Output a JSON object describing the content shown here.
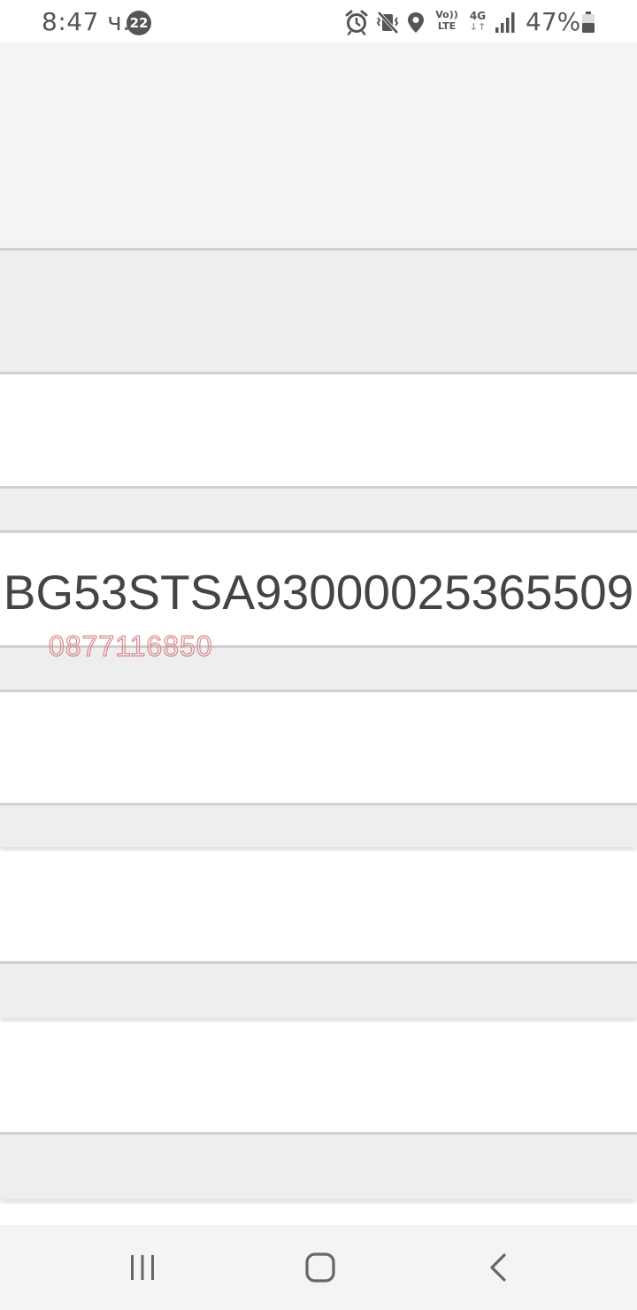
{
  "status_bar": {
    "time": "8:47 ч.",
    "notification_count": "22",
    "volte_top": "Vo))",
    "volte_bottom": "LTE",
    "network_type": "4G",
    "network_arrows": "↓↑",
    "battery_percent": "47%",
    "icons": [
      "alarm-icon",
      "vibrate-mute-icon",
      "location-icon",
      "volte-icon",
      "4g-icon",
      "signal-icon",
      "battery-icon"
    ]
  },
  "content": {
    "iban": "BG53STSA93000025365509",
    "phone_watermark": "0877116850"
  },
  "nav_bar": {
    "buttons": [
      "recents-icon",
      "home-icon",
      "back-icon"
    ]
  },
  "colors": {
    "status_text": "#555555",
    "iban_text": "#444444",
    "watermark": "#d9898d",
    "band_grey": "#eeeeee",
    "band_light": "#f4f4f4",
    "divider": "#d0d0d0"
  }
}
